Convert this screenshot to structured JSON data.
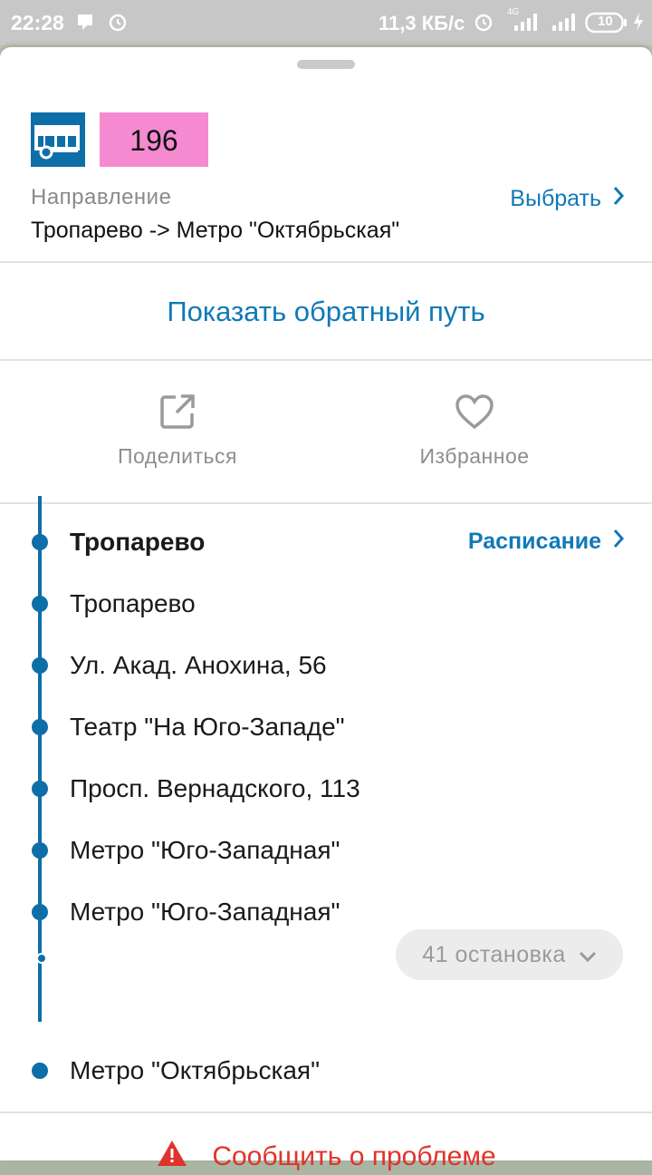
{
  "statusbar": {
    "time": "22:28",
    "speed": "11,3 КБ/с",
    "network": "4G",
    "battery": "10"
  },
  "route": {
    "icon": "tram-icon",
    "number": "196",
    "badge_color": "#f58ad1",
    "direction_label": "Направление",
    "direction_value": "Тропарево -> Метро \"Октябрьская\"",
    "choose_label": "Выбрать"
  },
  "reverse_label": "Показать обратный путь",
  "actions": {
    "share_label": "Поделиться",
    "favorite_label": "Избранное"
  },
  "stops": {
    "schedule_label": "Расписание",
    "items": [
      "Тропарево",
      "Тропарево",
      "Ул. Акад. Анохина, 56",
      "Театр \"На Юго-Западе\"",
      "Просп. Вернадского, 113",
      "Метро \"Юго-Западная\"",
      "Метро \"Юго-Западная\""
    ],
    "collapsed_label": "41 остановка",
    "last_stop": "Метро \"Октябрьская\""
  },
  "report_label": "Сообщить о проблеме",
  "colors": {
    "accent": "#1079b8",
    "line": "#0e6ea8",
    "warning": "#e0332b"
  }
}
